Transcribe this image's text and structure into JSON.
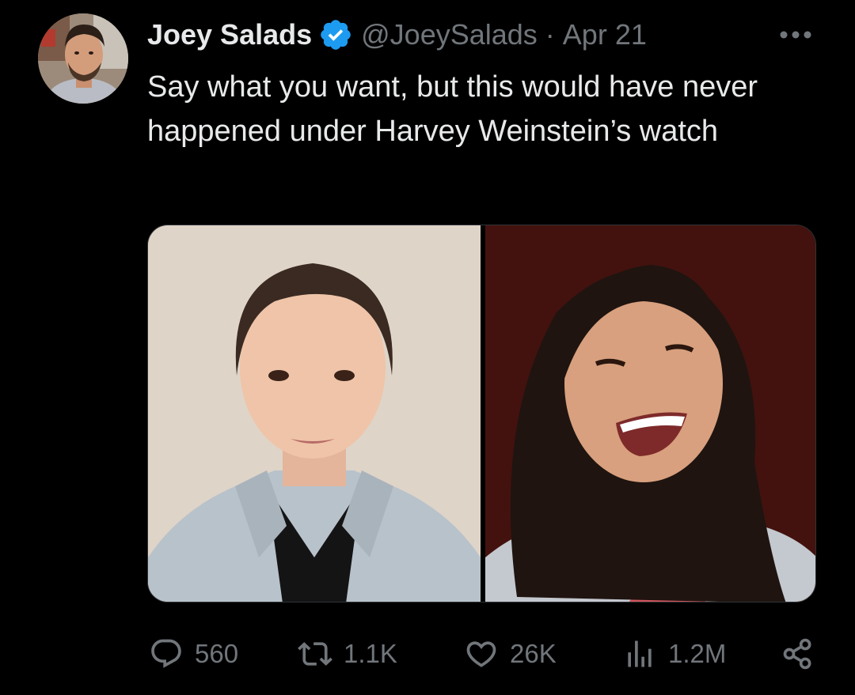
{
  "tweet": {
    "author": {
      "display_name": "Joey Salads",
      "handle": "@JoeySalads",
      "verified_icon": "verified-badge-icon",
      "badge_color": "#1d9bf0"
    },
    "separator": "·",
    "date": "Apr 21",
    "text": "Say what you want, but this would have never happened under Harvey Weinstein’s watch",
    "media": {
      "count": 2
    },
    "actions": {
      "replies": "560",
      "retweets": "1.1K",
      "likes": "26K",
      "views": "1.2M"
    }
  },
  "colors": {
    "background": "#000000",
    "primary_text": "#e7e9ea",
    "secondary_text": "#71767b",
    "accent": "#1d9bf0"
  }
}
